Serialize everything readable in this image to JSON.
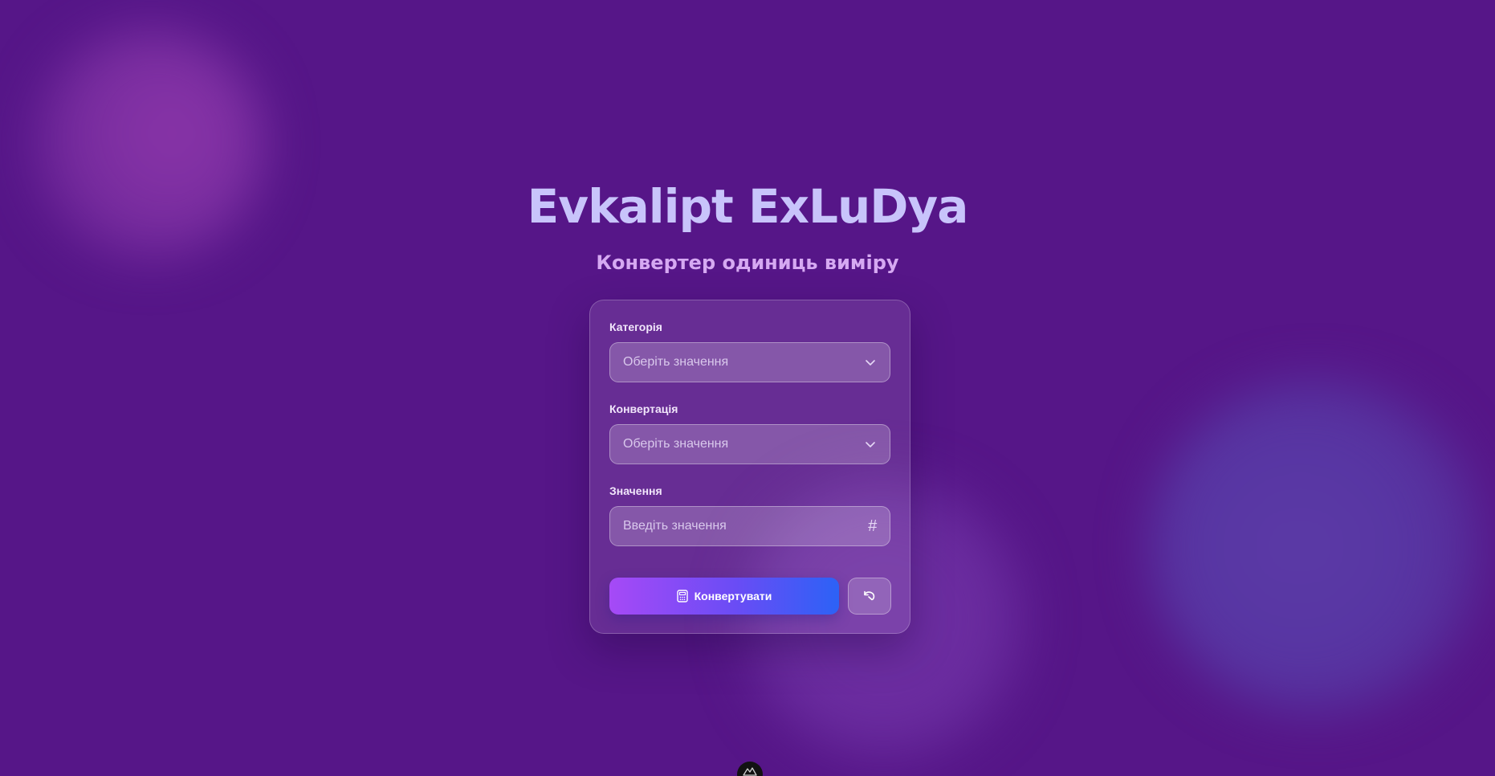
{
  "app": {
    "title": "Evkalipt ExLuDya",
    "subtitle": "Конвертер одиниць виміру"
  },
  "form": {
    "category": {
      "label": "Категорія",
      "placeholder": "Оберіть значення",
      "icon": "chevron-down-icon"
    },
    "conversion": {
      "label": "Конвертація",
      "placeholder": "Оберіть значення",
      "icon": "chevron-down-icon"
    },
    "value": {
      "label": "Значення",
      "placeholder": "Введіть значення",
      "icon": "hash-icon",
      "icon_glyph": "#",
      "current_value": ""
    },
    "convert_button": {
      "label": "Конвертувати",
      "icon": "calculator-icon"
    },
    "reset_button": {
      "icon": "reset-icon"
    }
  },
  "theme": {
    "background": "#561688",
    "title_color": "#c8c4fb",
    "subtitle_color": "#d6a9f2",
    "button_gradient_start": "#a64af6",
    "button_gradient_end": "#2c62f6"
  }
}
